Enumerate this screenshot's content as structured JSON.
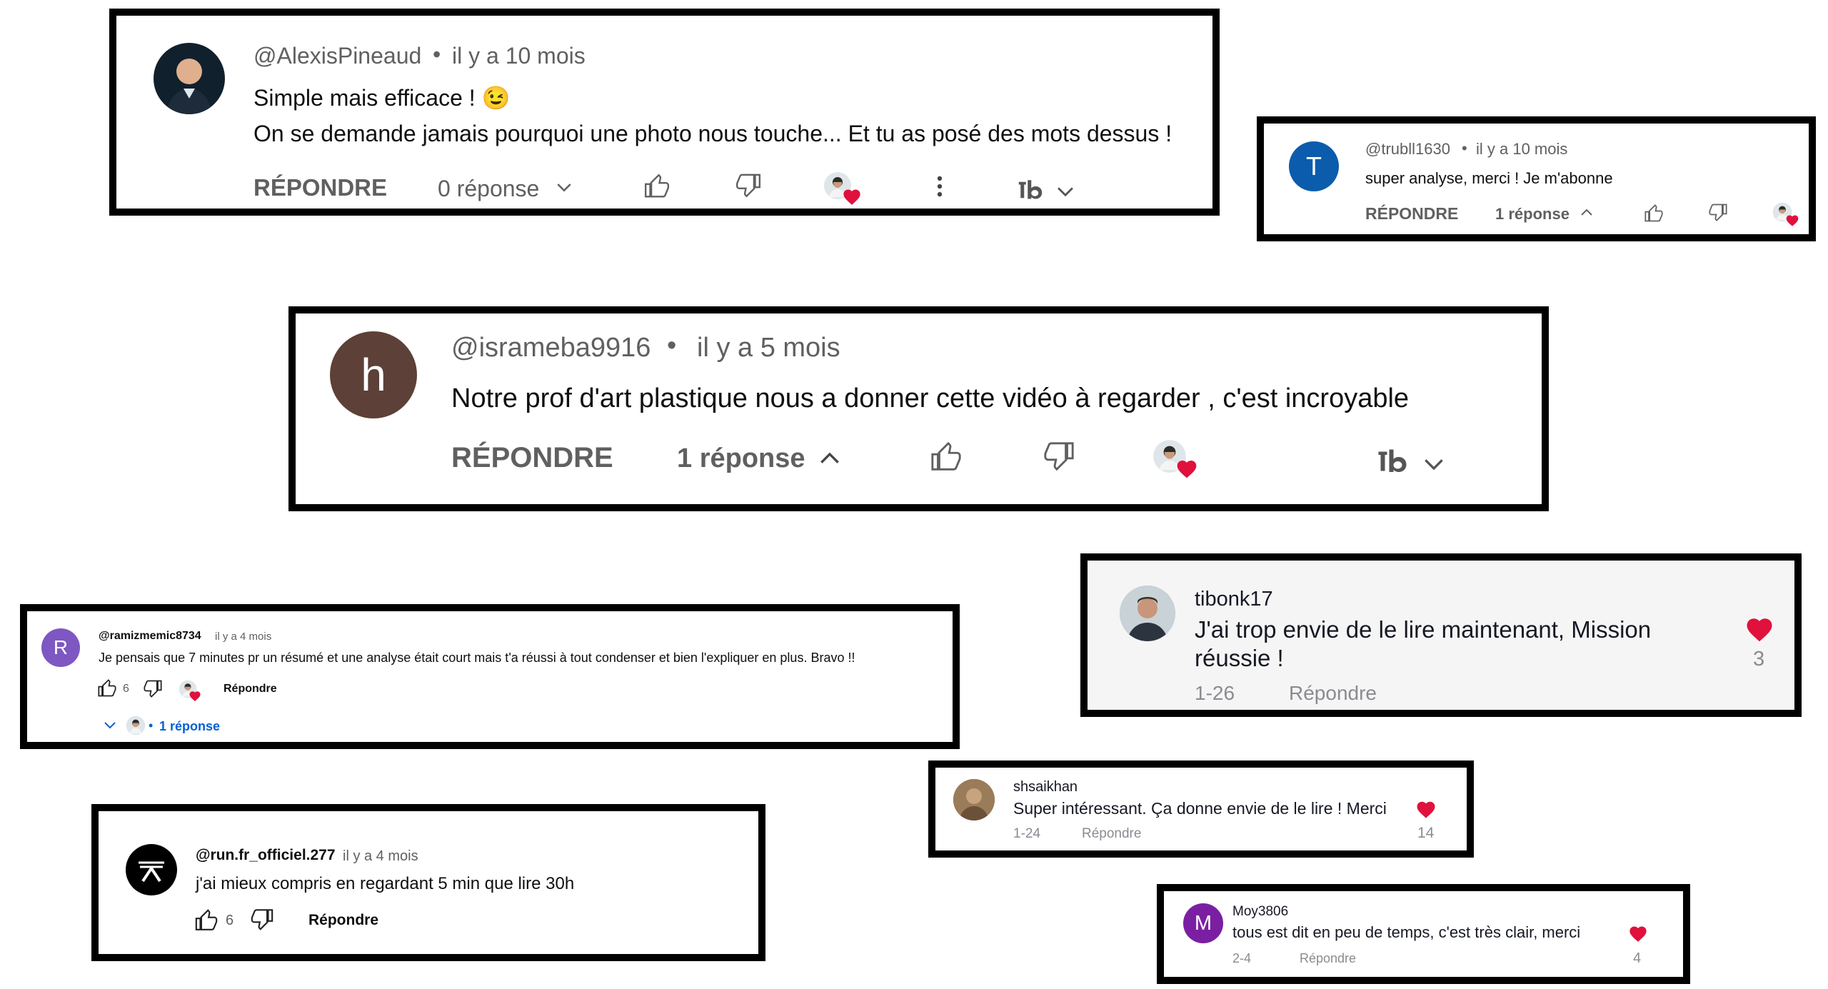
{
  "comments": [
    {
      "author": "@AlexisPineaud",
      "time": "il y a 10 mois",
      "line1": "Simple mais efficace ! 😉",
      "line2": "On se demande jamais pourquoi une photo nous touche... Et tu as posé des mots dessus !",
      "reply_label": "RÉPONDRE",
      "replies": "0 réponse"
    },
    {
      "author": "@trubll1630",
      "avatar_letter": "T",
      "time": "il y a 10 mois",
      "text": "super analyse, merci ! Je m'abonne",
      "reply_label": "RÉPONDRE",
      "replies": "1 réponse"
    },
    {
      "author": "@isrameba9916",
      "avatar_letter": "h",
      "time": "il y a 5 mois",
      "text": "Notre prof d'art plastique nous a donner cette vidéo à regarder , c'est incroyable",
      "reply_label": "RÉPONDRE",
      "replies": "1 réponse"
    },
    {
      "author": "@ramizmemic8734",
      "avatar_letter": "R",
      "time": "il y a 4 mois",
      "text": "Je pensais que 7 minutes pr un résumé et une analyse était court mais t'a réussi à tout condenser et bien l'expliquer en plus. Bravo !!",
      "likes": "6",
      "reply_label": "Répondre",
      "replies_link": "1 réponse"
    },
    {
      "author": "tibonk17",
      "text_line1": "J'ai trop envie de le lire maintenant, Mission",
      "text_line2": "réussie !",
      "date": "1-26",
      "reply_label": "Répondre",
      "likes": "3"
    },
    {
      "author": "shsaikhan",
      "text": "Super intéressant. Ça donne envie de le lire ! Merci",
      "date": "1-24",
      "reply_label": "Répondre",
      "likes": "14"
    },
    {
      "author": "@run.fr_officiel.277",
      "time": "il y a 4 mois",
      "text": "j'ai mieux compris en regardant 5 min que lire 30h",
      "likes": "6",
      "reply_label": "Répondre"
    },
    {
      "author": "Moy3806",
      "avatar_letter": "M",
      "text": "tous est dit en peu de temps, c'est très clair, merci",
      "date": "2-4",
      "reply_label": "Répondre",
      "likes": "4"
    }
  ],
  "colors": {
    "heart": "#e0113c",
    "blue_avatar": "#0b5cad",
    "brown_avatar": "#5d4037",
    "purple_R": "#7e57c2",
    "purple_M": "#7b1fa2",
    "link_blue": "#065fd4"
  }
}
